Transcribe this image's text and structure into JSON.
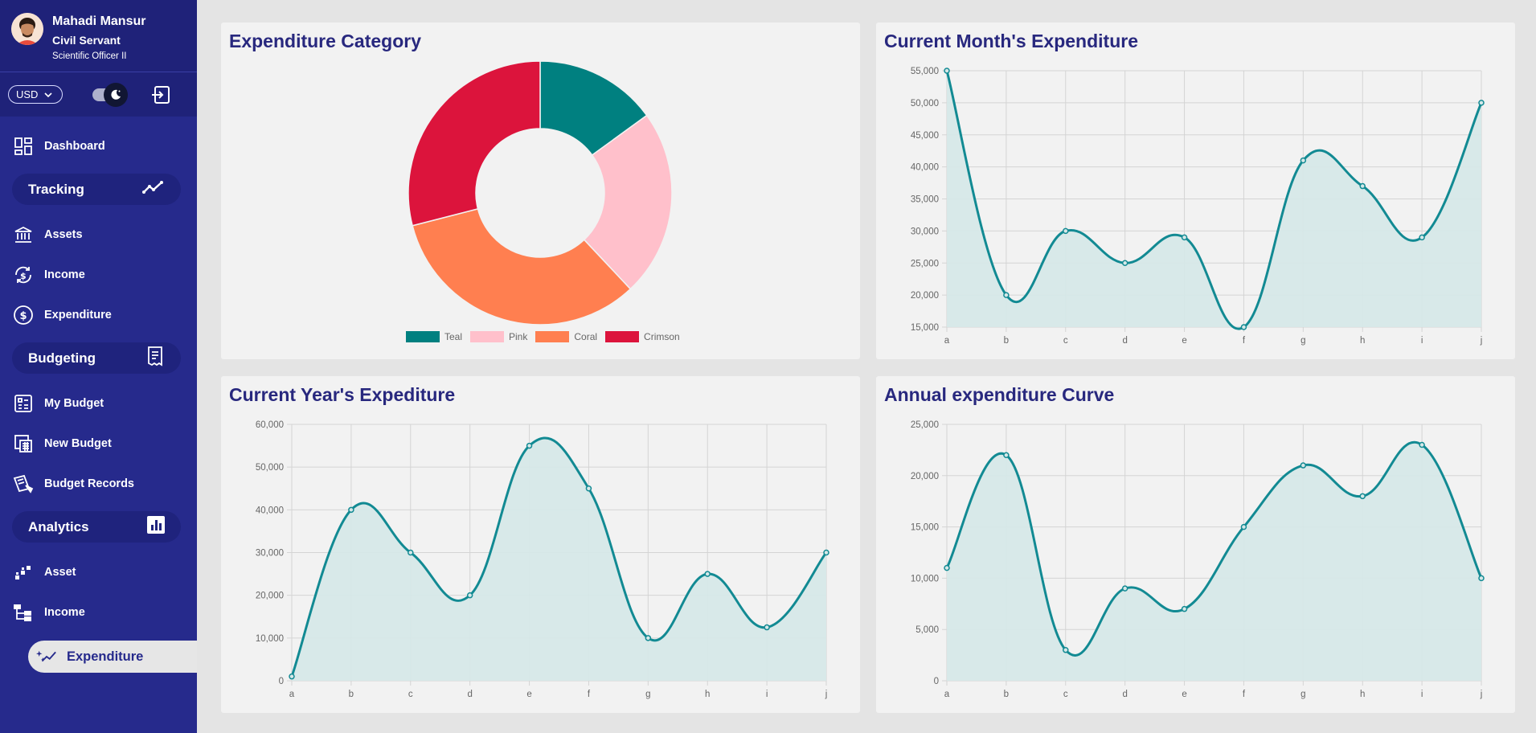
{
  "profile": {
    "name": "Mahadi Mansur",
    "role": "Civil Servant",
    "rank": "Scientific Officer II"
  },
  "controls": {
    "currency": "USD"
  },
  "nav": {
    "dashboard": "Dashboard",
    "tracking": "Tracking",
    "assets": "Assets",
    "income": "Income",
    "expenditure": "Expenditure",
    "budgeting": "Budgeting",
    "my_budget": "My Budget",
    "new_budget": "New Budget",
    "budget_records": "Budget Records",
    "analytics": "Analytics",
    "asset": "Asset",
    "income_analytics": "Income",
    "expenditure_active": "Expenditure"
  },
  "colors": {
    "sidebar": "#262a8c",
    "title": "#28287e",
    "line": "#128a93",
    "fill": "#d6e8e8"
  },
  "chart_data": [
    {
      "type": "pie",
      "title": "Expenditure Category",
      "categories": [
        "Teal",
        "Pink",
        "Coral",
        "Crimson"
      ],
      "values": [
        15,
        23,
        33,
        29
      ],
      "colors": [
        "#008080",
        "#ffc0cb",
        "#ff7f50",
        "#dc143c"
      ],
      "donut": true,
      "legend": "bottom"
    },
    {
      "type": "area",
      "title": "Current Month's Expenditure",
      "categories": [
        "a",
        "b",
        "c",
        "d",
        "e",
        "f",
        "g",
        "h",
        "i",
        "j"
      ],
      "values": [
        55000,
        20000,
        30000,
        25000,
        29000,
        15000,
        41000,
        37000,
        29000,
        50000
      ],
      "ylim": [
        15000,
        55000
      ],
      "yticks": [
        15000,
        20000,
        25000,
        30000,
        35000,
        40000,
        45000,
        50000,
        55000
      ],
      "grid": true
    },
    {
      "type": "area",
      "title": "Current Year's Expediture",
      "categories": [
        "a",
        "b",
        "c",
        "d",
        "e",
        "f",
        "g",
        "h",
        "i",
        "j"
      ],
      "values": [
        1000,
        40000,
        30000,
        20000,
        55000,
        45000,
        10000,
        25000,
        12500,
        30000
      ],
      "ylim": [
        0,
        60000
      ],
      "yticks": [
        0,
        10000,
        20000,
        30000,
        40000,
        50000,
        60000
      ],
      "grid": true
    },
    {
      "type": "area",
      "title": "Annual expenditure Curve",
      "categories": [
        "a",
        "b",
        "c",
        "d",
        "e",
        "f",
        "g",
        "h",
        "i",
        "j"
      ],
      "values": [
        11000,
        22000,
        3000,
        9000,
        7000,
        15000,
        21000,
        18000,
        23000,
        10000
      ],
      "ylim": [
        0,
        25000
      ],
      "yticks": [
        0,
        5000,
        10000,
        15000,
        20000,
        25000
      ],
      "grid": true
    }
  ]
}
